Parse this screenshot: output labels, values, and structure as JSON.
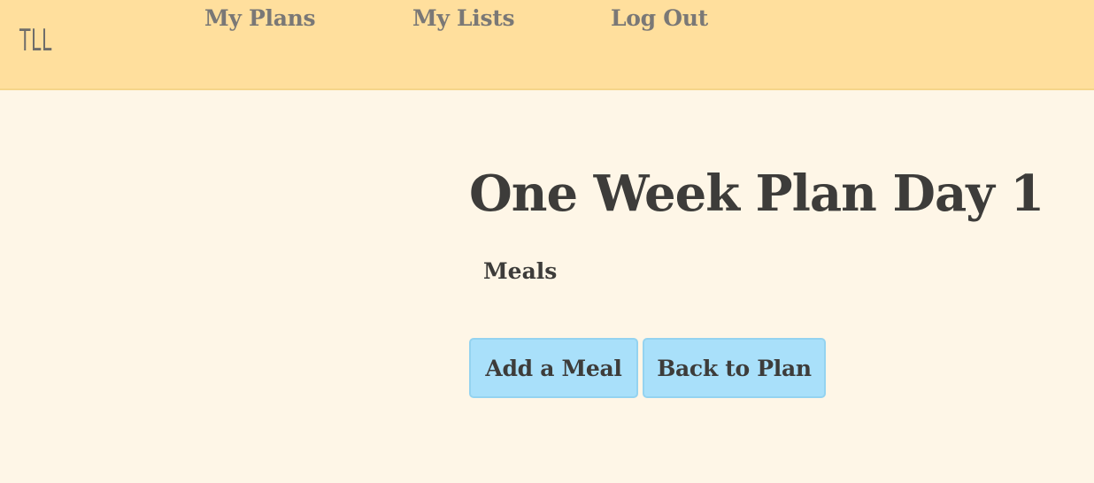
{
  "nav": {
    "logo": "TLL",
    "links": [
      "My Plans",
      "My Lists",
      "Log Out"
    ]
  },
  "main": {
    "title": "One Week Plan Day 1",
    "meals_heading": "Meals",
    "buttons": {
      "add_meal": "Add a Meal",
      "back_to_plan": "Back to Plan"
    }
  },
  "colors": {
    "navbar_bg": "#ffdf9d",
    "page_bg": "#fef6e7",
    "button_bg": "#a9e0fa",
    "text": "#3d3c3a"
  }
}
